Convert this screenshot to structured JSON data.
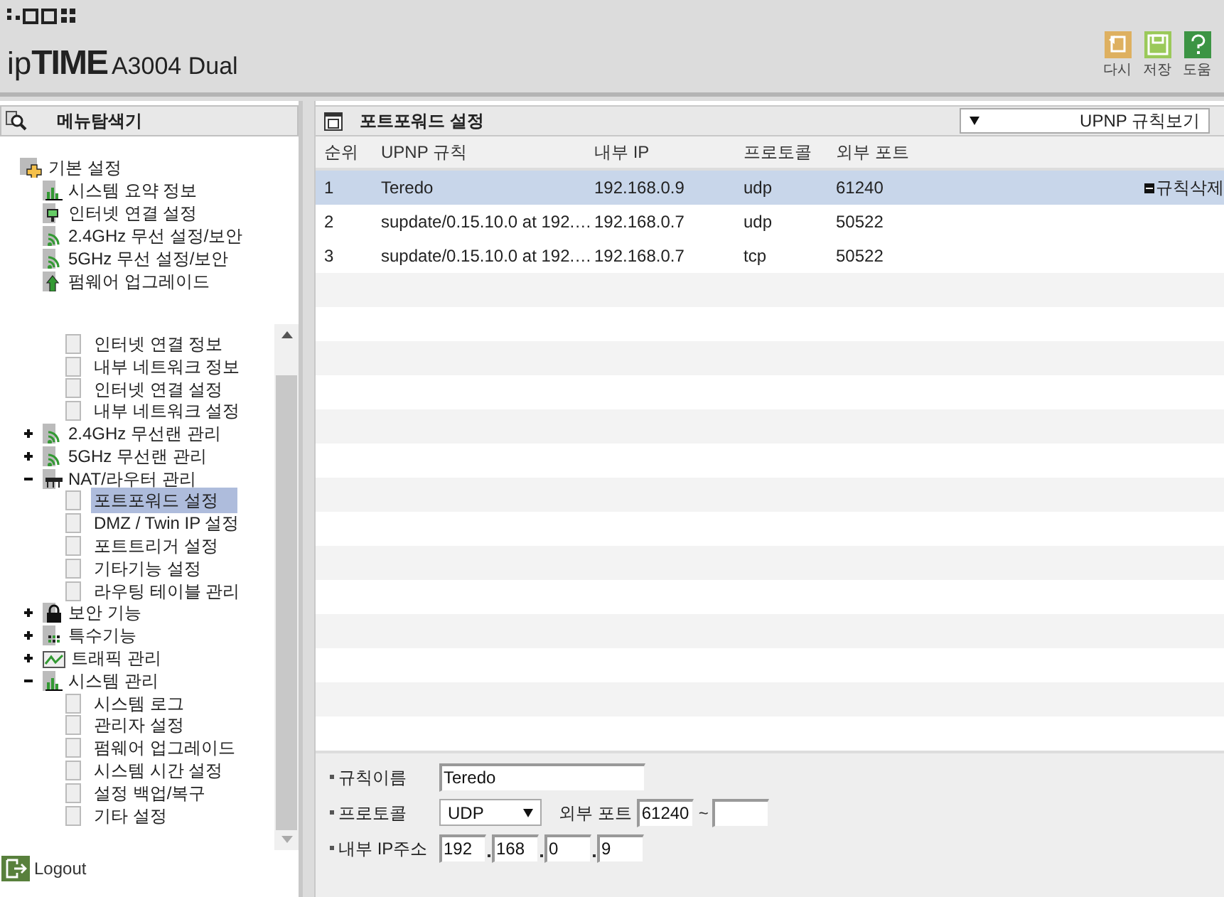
{
  "header": {
    "logo_prefix": "ip",
    "logo_brand": "TIME",
    "model": "A3004 Dual",
    "actions": [
      {
        "kind": "undo",
        "label": "다시"
      },
      {
        "kind": "save",
        "label": "저장"
      },
      {
        "kind": "help",
        "label": "도움"
      }
    ]
  },
  "sidebar": {
    "title": "메뉴탐색기",
    "basic": {
      "label": "기본 설정",
      "items": [
        {
          "kind": "chart",
          "label": "시스템 요약 정보"
        },
        {
          "kind": "monitor",
          "label": "인터넷 연결 설정"
        },
        {
          "kind": "wifi",
          "label": "2.4GHz 무선 설정/보안"
        },
        {
          "kind": "wifi",
          "label": "5GHz 무선 설정/보안"
        },
        {
          "kind": "upload",
          "label": "펌웨어 업그레이드"
        }
      ]
    },
    "tree": [
      {
        "kind": "page",
        "label": "인터넷 연결 정보",
        "selected": false
      },
      {
        "kind": "page",
        "label": "내부 네트워크 정보",
        "selected": false
      },
      {
        "kind": "page",
        "label": "인터넷 연결 설정",
        "selected": false
      },
      {
        "kind": "page",
        "label": "내부 네트워크 설정",
        "selected": false
      },
      {
        "kind": "wifi",
        "label": "2.4GHz 무선랜 관리",
        "expanded": false
      },
      {
        "kind": "wifi",
        "label": "5GHz 무선랜 관리",
        "expanded": false
      },
      {
        "kind": "router",
        "label": "NAT/라우터 관리",
        "expanded": true,
        "children": [
          {
            "label": "포트포워드 설정",
            "selected": true
          },
          {
            "label": "DMZ / Twin IP 설정",
            "selected": false
          },
          {
            "label": "포트트리거 설정",
            "selected": false
          },
          {
            "label": "기타기능 설정",
            "selected": false
          },
          {
            "label": "라우팅 테이블 관리",
            "selected": false
          }
        ]
      },
      {
        "kind": "lock",
        "label": "보안 기능",
        "expanded": false
      },
      {
        "kind": "grid",
        "label": "특수기능",
        "expanded": false
      },
      {
        "kind": "traffic",
        "label": "트래픽 관리",
        "expanded": false
      },
      {
        "kind": "chart",
        "label": "시스템 관리",
        "expanded": true,
        "children": [
          {
            "label": "시스템 로그",
            "selected": false
          },
          {
            "label": "관리자 설정",
            "selected": false
          },
          {
            "label": "펌웨어 업그레이드",
            "selected": false
          },
          {
            "label": "시스템 시간 설정",
            "selected": false
          },
          {
            "label": "설정 백업/복구",
            "selected": false
          },
          {
            "label": "기타 설정",
            "selected": false
          }
        ]
      }
    ],
    "logout": "Logout"
  },
  "main": {
    "title": "포트포워드 설정",
    "view_select": "UPNP 규칙보기",
    "table": {
      "columns": [
        "순위",
        "UPNP 규칙",
        "내부 IP",
        "프로토콜",
        "외부 포트"
      ],
      "rows": [
        {
          "cells": [
            "1",
            "Teredo",
            "192.168.0.9",
            "udp",
            "61240"
          ],
          "selected": true,
          "action": "규칙삭제"
        },
        {
          "cells": [
            "2",
            "supdate/0.15.10.0 at 192.…",
            "192.168.0.7",
            "udp",
            "50522"
          ],
          "selected": false
        },
        {
          "cells": [
            "3",
            "supdate/0.15.10.0 at 192.…",
            "192.168.0.7",
            "tcp",
            "50522"
          ],
          "selected": false
        }
      ]
    },
    "form": {
      "name_label": "규칙이름",
      "name_value": "Teredo",
      "protocol_label": "프로토콜",
      "protocol_value": "UDP",
      "ext_port_label": "외부 포트",
      "ext_port_from": "61240",
      "tilde": "~",
      "ip_label": "내부 IP주소",
      "ip_parts": [
        "192",
        "168",
        "0",
        "9"
      ]
    }
  }
}
